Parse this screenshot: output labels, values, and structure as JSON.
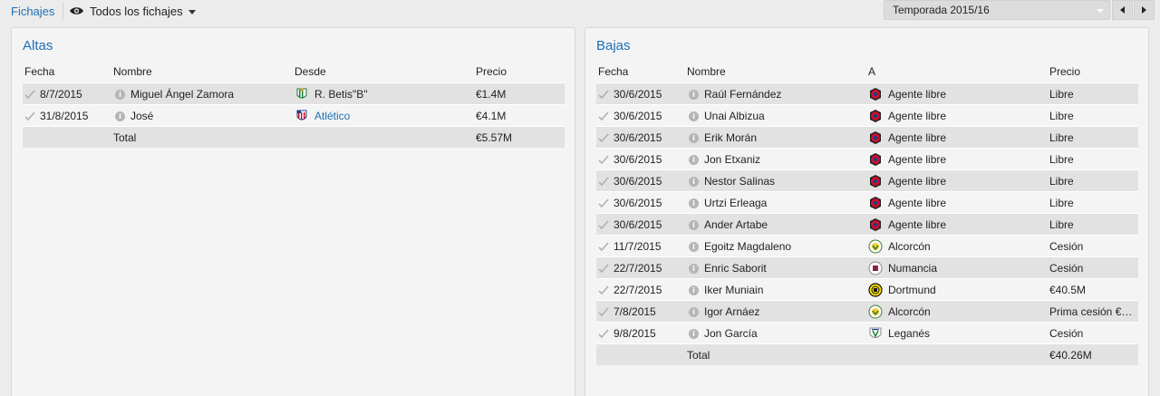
{
  "topbar": {
    "tab_label": "Fichajes",
    "view_label": "Todos los fichajes",
    "season_label": "Temporada 2015/16"
  },
  "altas": {
    "title": "Altas",
    "headers": {
      "date": "Fecha",
      "name": "Nombre",
      "club": "Desde",
      "price": "Precio"
    },
    "rows": [
      {
        "date": "8/7/2015",
        "name": "Miguel Ángel Zamora",
        "club": "R. Betis\"B\"",
        "club_is_link": false,
        "crest": "betis",
        "price": "€1.4M"
      },
      {
        "date": "31/8/2015",
        "name": "José",
        "club": "Atlético",
        "club_is_link": true,
        "crest": "atletico",
        "price": "€4.1M"
      }
    ],
    "total": {
      "label": "Total",
      "price": "€5.57M"
    }
  },
  "bajas": {
    "title": "Bajas",
    "headers": {
      "date": "Fecha",
      "name": "Nombre",
      "club": "A",
      "price": "Precio"
    },
    "rows": [
      {
        "date": "30/6/2015",
        "name": "Raúl Fernández",
        "club": "Agente libre",
        "crest": "free",
        "price": "Libre"
      },
      {
        "date": "30/6/2015",
        "name": "Unai Albizua",
        "club": "Agente libre",
        "crest": "free",
        "price": "Libre"
      },
      {
        "date": "30/6/2015",
        "name": "Erik Morán",
        "club": "Agente libre",
        "crest": "free",
        "price": "Libre"
      },
      {
        "date": "30/6/2015",
        "name": "Jon Etxaniz",
        "club": "Agente libre",
        "crest": "free",
        "price": "Libre"
      },
      {
        "date": "30/6/2015",
        "name": "Nestor Salinas",
        "club": "Agente libre",
        "crest": "free",
        "price": "Libre"
      },
      {
        "date": "30/6/2015",
        "name": "Urtzi Erleaga",
        "club": "Agente libre",
        "crest": "free",
        "price": "Libre"
      },
      {
        "date": "30/6/2015",
        "name": "Ander Artabe",
        "club": "Agente libre",
        "crest": "free",
        "price": "Libre"
      },
      {
        "date": "11/7/2015",
        "name": "Egoitz Magdaleno",
        "club": "Alcorcón",
        "crest": "alcorcon",
        "price": "Cesión"
      },
      {
        "date": "22/7/2015",
        "name": "Enric Saborit",
        "club": "Numancia",
        "crest": "numancia",
        "price": "Cesión"
      },
      {
        "date": "22/7/2015",
        "name": "Iker Muniain",
        "club": "Dortmund",
        "crest": "dortmund",
        "price": "€40.5M"
      },
      {
        "date": "7/8/2015",
        "name": "Igor Arnáez",
        "club": "Alcorcón",
        "crest": "alcorcon",
        "price": "Prima cesión €1..."
      },
      {
        "date": "9/8/2015",
        "name": "Jon García",
        "club": "Leganés",
        "crest": "leganes",
        "price": "Cesión"
      }
    ],
    "total": {
      "label": "Total",
      "price": "€40.26M"
    }
  },
  "colors": {
    "accent": "#1f6fb5",
    "row_shade": "#e2e2e2",
    "panel_bg": "#f4f4f4"
  },
  "icons": {
    "check": "checkmark-icon",
    "info": "info-icon",
    "eye": "eye-icon"
  }
}
